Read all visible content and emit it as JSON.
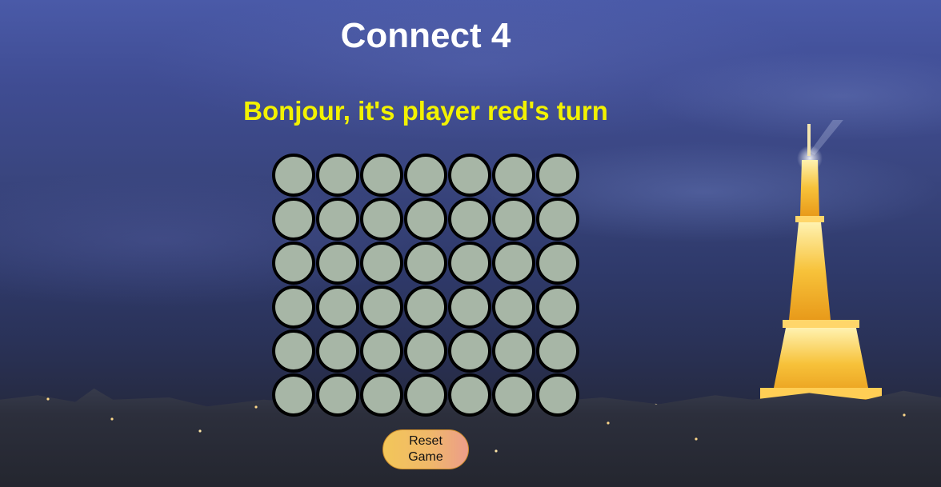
{
  "game": {
    "title": "Connect 4",
    "status": "Bonjour, it's player red's turn",
    "reset_label": "Reset Game",
    "board": {
      "rows": 6,
      "columns": 7,
      "cells": [
        [
          "empty",
          "empty",
          "empty",
          "empty",
          "empty",
          "empty",
          "empty"
        ],
        [
          "empty",
          "empty",
          "empty",
          "empty",
          "empty",
          "empty",
          "empty"
        ],
        [
          "empty",
          "empty",
          "empty",
          "empty",
          "empty",
          "empty",
          "empty"
        ],
        [
          "empty",
          "empty",
          "empty",
          "empty",
          "empty",
          "empty",
          "empty"
        ],
        [
          "empty",
          "empty",
          "empty",
          "empty",
          "empty",
          "empty",
          "empty"
        ],
        [
          "empty",
          "empty",
          "empty",
          "empty",
          "empty",
          "empty",
          "empty"
        ]
      ]
    }
  },
  "colors": {
    "title": "#ffffff",
    "status": "#f2f200",
    "empty_slot": "#a7b6a6",
    "slot_border": "#000000",
    "button_gradient_start": "#f3c659",
    "button_gradient_end": "#ec9d8a"
  }
}
